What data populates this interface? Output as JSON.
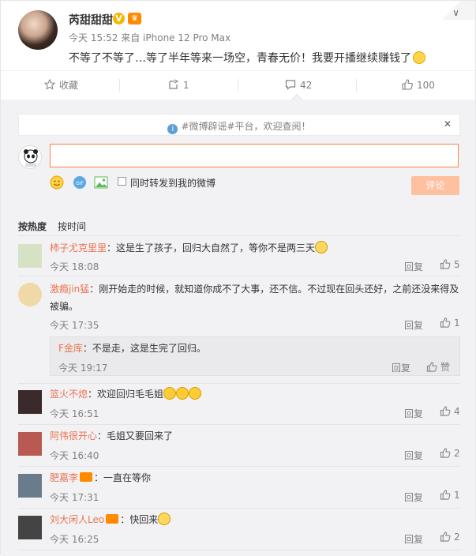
{
  "post": {
    "author": "芮甜甜甜",
    "time": "今天 15:52",
    "source": "来自 iPhone 12 Pro Max",
    "text": "不等了不等了…等了半年等来一场空，青春无价！我要开播继续赚钱了"
  },
  "actions": {
    "favorite": "收藏",
    "repost": "1",
    "comment": "42",
    "like": "100"
  },
  "notice": {
    "text": "#微博辟谣#平台，欢迎查阅！"
  },
  "composer": {
    "repost_option": "同时转发到我的微博",
    "submit": "评论"
  },
  "sort": {
    "by_hot": "按热度",
    "by_time": "按时间"
  },
  "comments": [
    {
      "name": "柿子尤克里里",
      "text": "：这是生了孩子，回归大自然了，等你不是两三天",
      "time": "今天 18:08",
      "reply": "回复",
      "likes": "5",
      "avatar_color": "#d7e2c4"
    },
    {
      "name": "激瘾jin猛",
      "text": "：刚开始走的时候，就知道你成不了大事，还不信。不过现在回头还好，之前还没来得及",
      "text2": "被骗。",
      "time": "今天 17:35",
      "reply": "回复",
      "likes": "1",
      "avatar_color": "#f0d9a8"
    },
    {
      "name": "F金库",
      "text": "：不是走，这是生完了回归。",
      "time": "今天 19:17",
      "reply": "回复",
      "likes": "赞"
    },
    {
      "name": "篮火不熄",
      "text": "：欢迎回归毛毛姐",
      "time": "今天 16:51",
      "reply": "回复",
      "likes": "4",
      "avatar_color": "#3a2a2c"
    },
    {
      "name": "阿伟很开心",
      "text": "：毛姐又要回来了",
      "time": "今天 16:40",
      "reply": "回复",
      "likes": "2",
      "avatar_color": "#b85a52"
    },
    {
      "name": "肥嘉李",
      "text": "：一直在等你",
      "time": "今天 17:31",
      "reply": "回复",
      "likes": "1",
      "avatar_color": "#6a7c8c"
    },
    {
      "name": "刘大闲人Leo",
      "text": "：快回来",
      "time": "今天 16:25",
      "reply": "回复",
      "likes": "2",
      "avatar_color": "#444444"
    }
  ],
  "colors": {
    "accent": "#eb7350",
    "input_border": "#ff8140",
    "button_disabled": "#ffc09f",
    "panel_bg": "#f2f2f5"
  },
  "icons": [
    "verified-icon",
    "member-crown-icon",
    "chevron-down-icon",
    "star-icon",
    "repost-icon",
    "comment-icon",
    "like-icon",
    "info-icon",
    "close-icon",
    "emoji-icon",
    "gif-icon",
    "image-icon"
  ]
}
